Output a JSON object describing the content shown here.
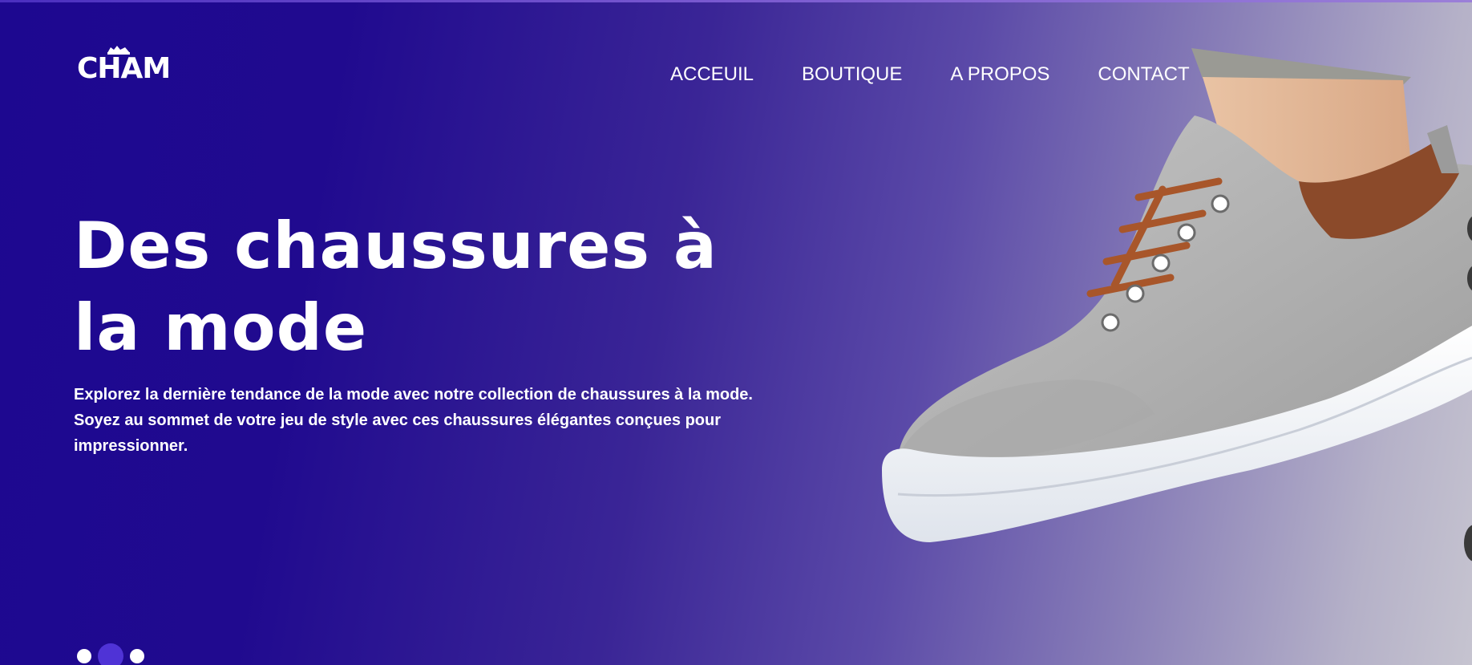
{
  "header": {
    "logo_text": "CHAM",
    "nav": [
      {
        "label": "ACCEUIL"
      },
      {
        "label": "BOUTIQUE"
      },
      {
        "label": "A PROPOS"
      },
      {
        "label": "CONTACT"
      }
    ]
  },
  "hero": {
    "headline": "Des chaussures à la mode",
    "description": "Explorez la dernière tendance de la mode avec notre collection de chaussures à la mode. Soyez au sommet de votre jeu de style avec ces chaussures élégantes conçues pour impressionner.",
    "slider": {
      "count": 3,
      "active_index": 1
    }
  },
  "colors": {
    "gradient_start": "#1d0890",
    "gradient_end": "#c6c4d0",
    "active_dot": "#4f33d6",
    "text": "#ffffff"
  },
  "icons": {
    "logo": "sneaker-logo-icon",
    "product": "sneaker-image"
  }
}
